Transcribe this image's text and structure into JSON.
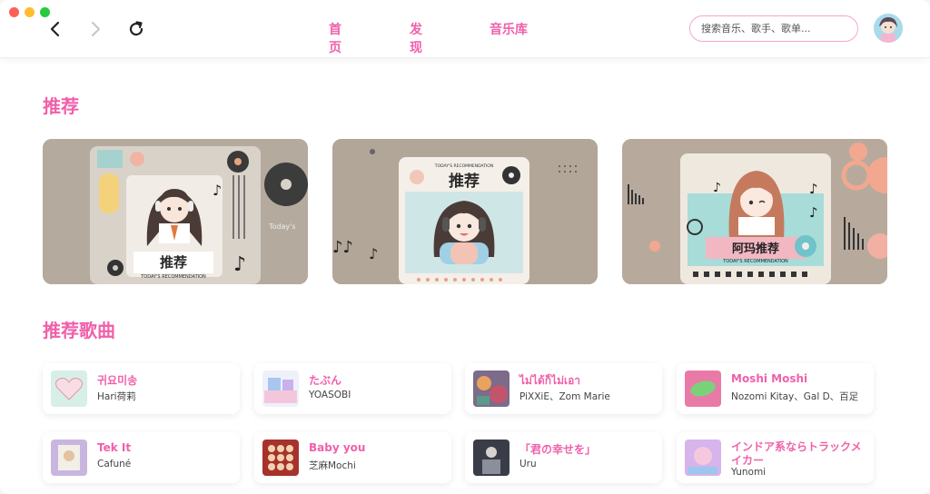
{
  "nav": {
    "links": [
      "首页",
      "发现",
      "音乐库"
    ]
  },
  "search": {
    "placeholder": "搜索音乐、歌手、歌单..."
  },
  "sections": {
    "recommend_title": "推荐",
    "songs_title": "推荐歌曲"
  },
  "recommend_cards": [
    {
      "caption": "推荐",
      "subtitle": "TODAY'S RECOMMENDATION",
      "side_text": "Today's"
    },
    {
      "caption": "推荐",
      "subtitle": "TODAY'S RECOMMENDATION"
    },
    {
      "caption": "阿玛推荐",
      "subtitle": "TODAY'S RECOMMENDATION"
    }
  ],
  "songs": [
    {
      "title": "귀요미송",
      "artist": "Hari荷莉"
    },
    {
      "title": "たぶん",
      "artist": "YOASOBI"
    },
    {
      "title": "ไม่ได้ก็ไม่เอา",
      "artist": "PiXXiE、Zom Marie"
    },
    {
      "title": "Moshi Moshi",
      "artist": "Nozomi Kitay、Gal D、百足"
    },
    {
      "title": "Tek It",
      "artist": "Cafuné"
    },
    {
      "title": "Baby you",
      "artist": "芝麻Mochi"
    },
    {
      "title": "「君の幸せを」",
      "artist": "Uru"
    },
    {
      "title": "インドア系ならトラックメイカー",
      "artist": "Yunomi"
    }
  ],
  "colors": {
    "accent": "#f060aa",
    "card_bg": "#b5aa9f"
  }
}
